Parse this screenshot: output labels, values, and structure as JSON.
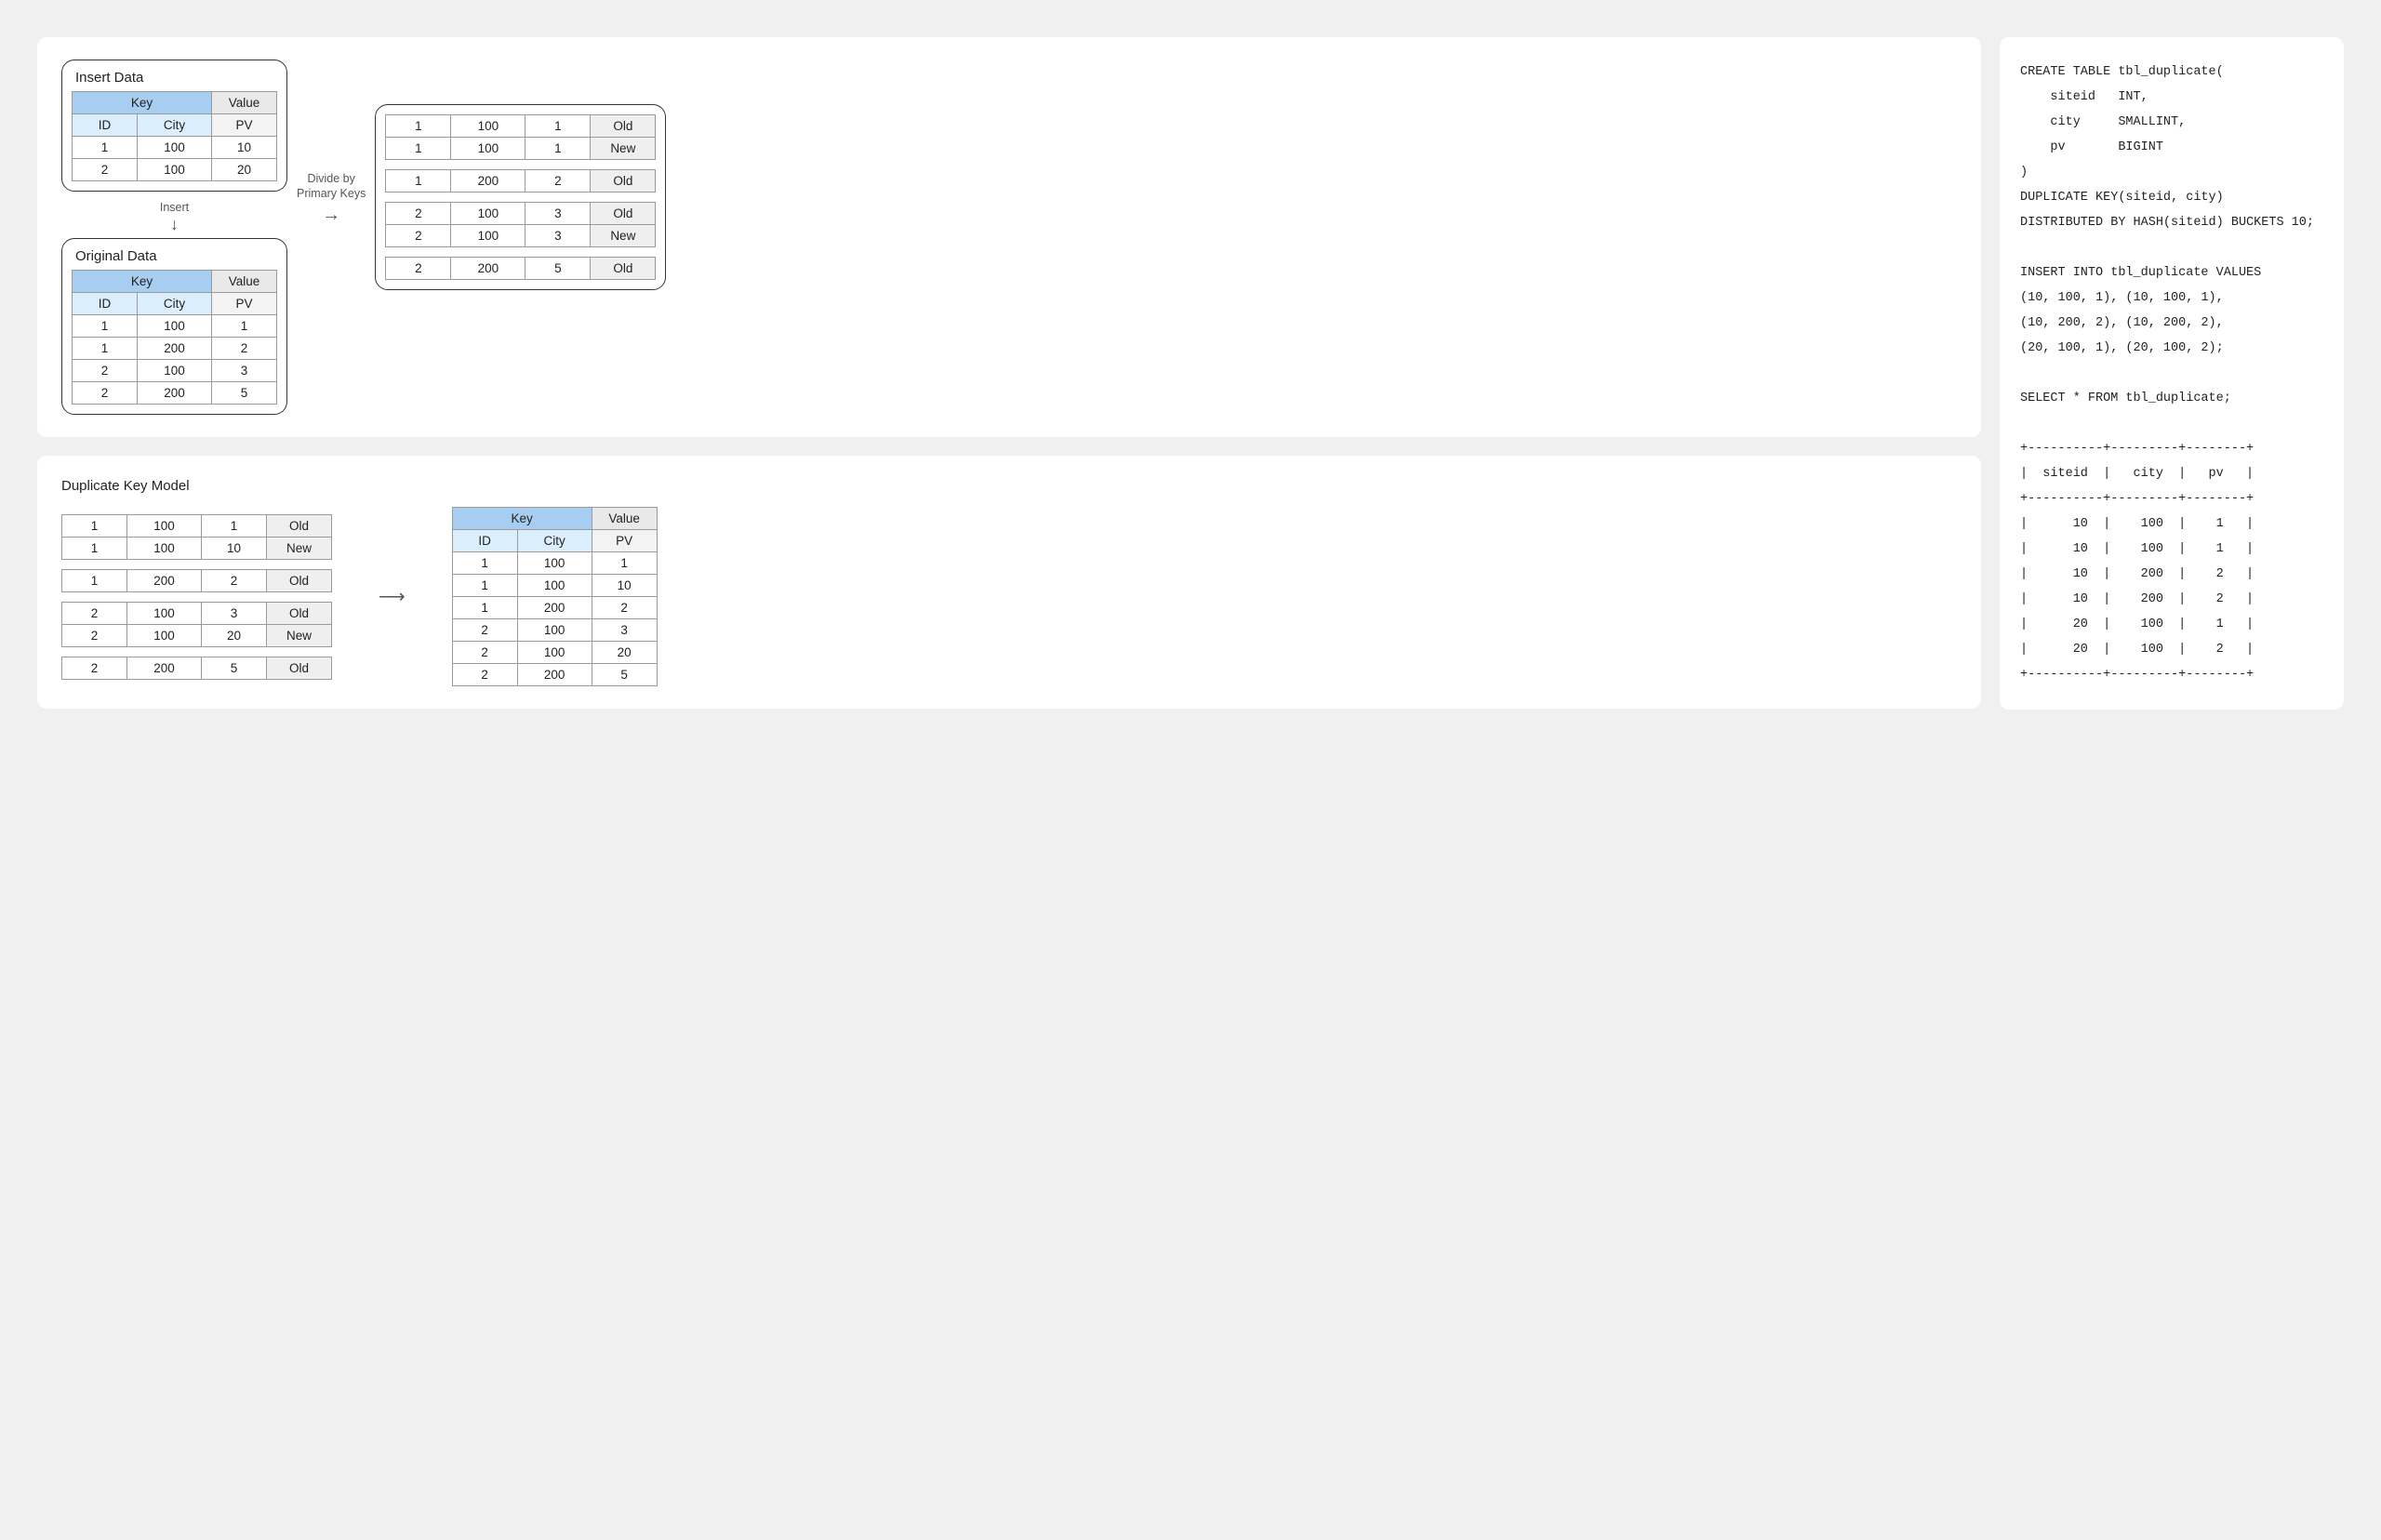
{
  "top": {
    "insert_title": "Insert Data",
    "original_title": "Original Data",
    "headers": {
      "key": "Key",
      "value": "Value",
      "id": "ID",
      "city": "City",
      "pv": "PV"
    },
    "insert_rows": [
      {
        "id": "1",
        "city": "100",
        "pv": "10"
      },
      {
        "id": "2",
        "city": "100",
        "pv": "20"
      }
    ],
    "original_rows": [
      {
        "id": "1",
        "city": "100",
        "pv": "1"
      },
      {
        "id": "1",
        "city": "200",
        "pv": "2"
      },
      {
        "id": "2",
        "city": "100",
        "pv": "3"
      },
      {
        "id": "2",
        "city": "200",
        "pv": "5"
      }
    ],
    "insert_label": "Insert",
    "divide_label_1": "Divide by",
    "divide_label_2": "Primary Keys",
    "tags": {
      "old": "Old",
      "new": "New"
    },
    "group1": [
      {
        "id": "1",
        "city": "100",
        "pv": "1",
        "tag": "Old"
      },
      {
        "id": "1",
        "city": "100",
        "pv": "1",
        "tag": "New"
      }
    ],
    "group2": [
      {
        "id": "1",
        "city": "200",
        "pv": "2",
        "tag": "Old"
      }
    ],
    "group3": [
      {
        "id": "2",
        "city": "100",
        "pv": "3",
        "tag": "Old"
      },
      {
        "id": "2",
        "city": "100",
        "pv": "3",
        "tag": "New"
      }
    ],
    "group4": [
      {
        "id": "2",
        "city": "200",
        "pv": "5",
        "tag": "Old"
      }
    ]
  },
  "bottom": {
    "title": "Duplicate Key Model",
    "stage1": [
      {
        "id": "1",
        "city": "100",
        "pv": "1",
        "tag": "Old"
      },
      {
        "id": "1",
        "city": "100",
        "pv": "10",
        "tag": "New"
      }
    ],
    "stage2": [
      {
        "id": "1",
        "city": "200",
        "pv": "2",
        "tag": "Old"
      }
    ],
    "stage3": [
      {
        "id": "2",
        "city": "100",
        "pv": "3",
        "tag": "Old"
      },
      {
        "id": "2",
        "city": "100",
        "pv": "20",
        "tag": "New"
      }
    ],
    "stage4": [
      {
        "id": "2",
        "city": "200",
        "pv": "5",
        "tag": "Old"
      }
    ],
    "result_headers": {
      "key": "Key",
      "value": "Value",
      "id": "ID",
      "city": "City",
      "pv": "PV"
    },
    "result_rows": [
      {
        "id": "1",
        "city": "100",
        "pv": "1"
      },
      {
        "id": "1",
        "city": "100",
        "pv": "10"
      },
      {
        "id": "1",
        "city": "200",
        "pv": "2"
      },
      {
        "id": "2",
        "city": "100",
        "pv": "3"
      },
      {
        "id": "2",
        "city": "100",
        "pv": "20"
      },
      {
        "id": "2",
        "city": "200",
        "pv": "5"
      }
    ]
  },
  "code": {
    "lines": [
      "CREATE TABLE tbl_duplicate(",
      "    siteid   INT,",
      "    city     SMALLINT,",
      "    pv       BIGINT",
      ")",
      "DUPLICATE KEY(siteid, city)",
      "DISTRIBUTED BY HASH(siteid) BUCKETS 10;",
      "",
      "INSERT INTO tbl_duplicate VALUES",
      "(10, 100, 1), (10, 100, 1),",
      "(10, 200, 2), (10, 200, 2),",
      "(20, 100, 1), (20, 100, 2);",
      "",
      "SELECT * FROM tbl_duplicate;",
      "",
      "+----------+---------+--------+",
      "|  siteid  |   city  |   pv   |",
      "+----------+---------+--------+",
      "|      10  |    100  |    1   |",
      "|      10  |    100  |    1   |",
      "|      10  |    200  |    2   |",
      "|      10  |    200  |    2   |",
      "|      20  |    100  |    1   |",
      "|      20  |    100  |    2   |",
      "+----------+---------+--------+"
    ]
  }
}
